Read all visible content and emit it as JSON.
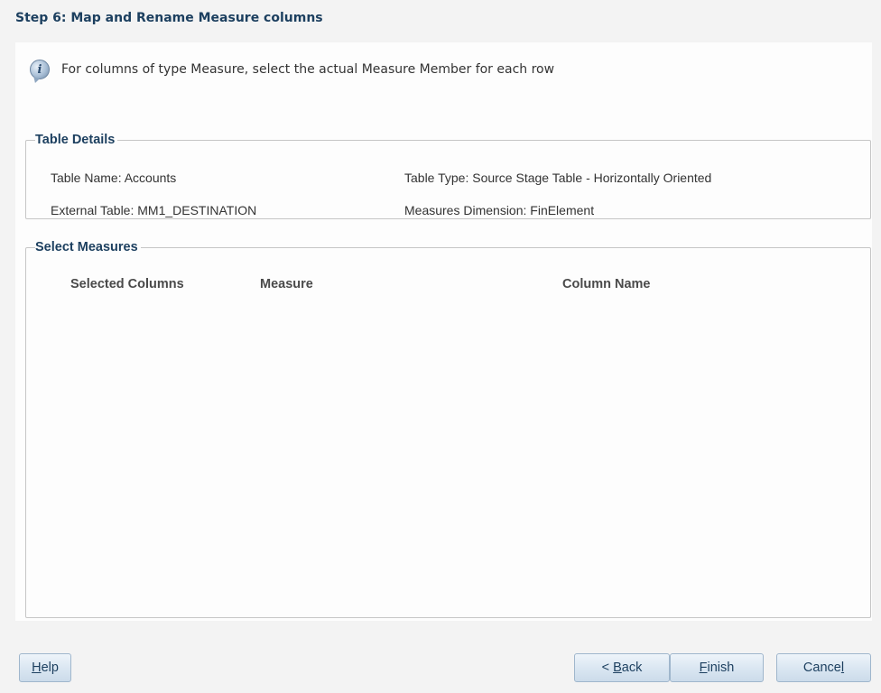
{
  "step_title": "Step 6: Map and Rename Measure columns",
  "info_message": "For columns of type Measure, select the actual Measure Member for each row",
  "table_details": {
    "legend": "Table Details",
    "table_name": "Table Name: Accounts",
    "table_type": "Table Type: Source Stage Table - Horizontally Oriented",
    "external_table": "External Table: MM1_DESTINATION",
    "measures_dimension": "Measures Dimension: FinElement"
  },
  "select_measures": {
    "legend": "Select Measures",
    "columns": [
      "Selected Columns",
      "Measure",
      "Column Name"
    ],
    "rows": []
  },
  "buttons": {
    "help": {
      "mnemonic": "H",
      "rest": "elp"
    },
    "back": {
      "prefix": "< ",
      "mnemonic": "B",
      "rest": "ack"
    },
    "finish": {
      "mnemonic": "F",
      "rest": "inish"
    },
    "cancel": {
      "prefix": "Cance",
      "mnemonic": "l"
    }
  }
}
